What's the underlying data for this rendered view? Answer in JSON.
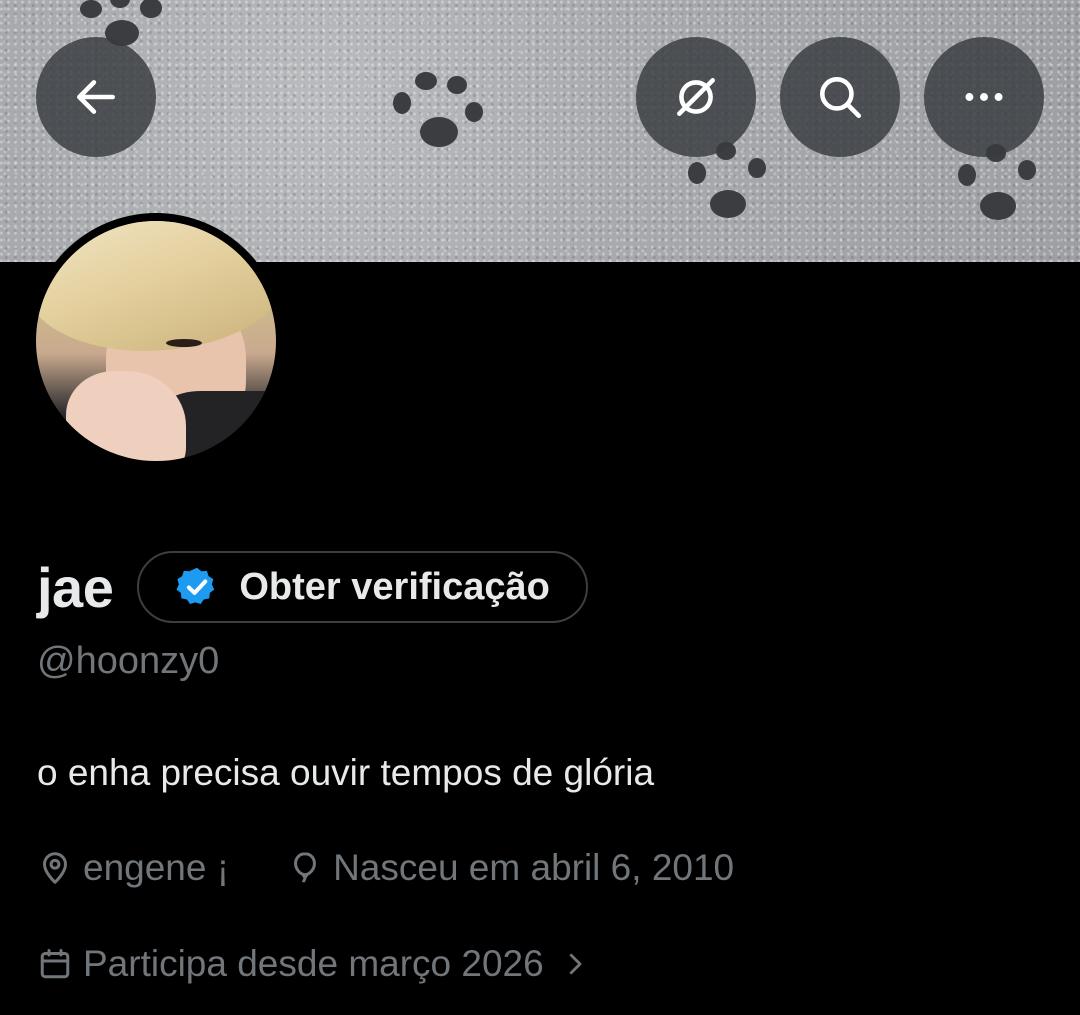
{
  "header": {
    "back_icon": "arrow-left-icon",
    "grok_icon": "grok-icon",
    "search_icon": "search-icon",
    "more_icon": "more-horizontal-icon"
  },
  "profile": {
    "display_name": "jae",
    "verify_label": "Obter verificação",
    "handle": "@hoonzy0",
    "bio": "o enha precisa ouvir tempos de glória",
    "location": "engene ¡",
    "birthday": "Nasceu em abril 6, 2010",
    "joined": "Participa desde março 2026"
  },
  "colors": {
    "background": "#000000",
    "primary_text": "#e7e9ea",
    "secondary_text": "#71767b",
    "verified_blue": "#1d9bf0",
    "button_overlay": "#373a3e"
  }
}
